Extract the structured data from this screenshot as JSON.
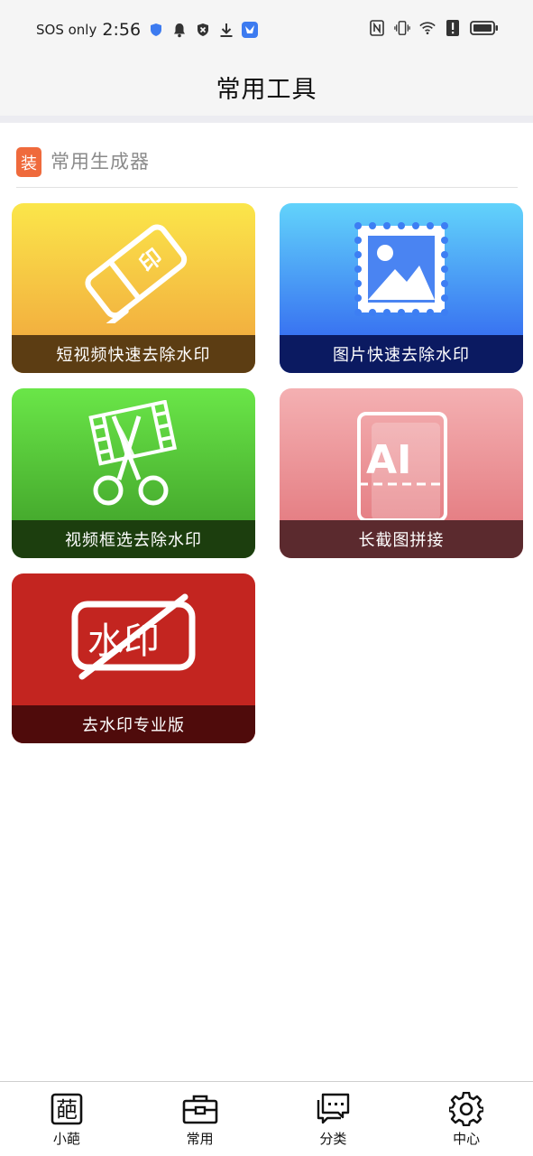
{
  "status_bar": {
    "carrier": "SOS only",
    "time": "2:56",
    "left_icons": [
      "shield-icon",
      "bell-icon",
      "vpn-shield-icon",
      "download-icon",
      "app-bird-icon"
    ],
    "right_icons": [
      "nfc-icon",
      "vibrate-icon",
      "wifi-icon",
      "alert-icon",
      "battery-icon"
    ]
  },
  "header": {
    "title": "常用工具"
  },
  "section": {
    "badge": "装",
    "title": "常用生成器"
  },
  "tools": [
    {
      "label": "短视频快速去除水印",
      "icon": "eraser-stamp-icon",
      "stamp_text": "印"
    },
    {
      "label": "图片快速去除水印",
      "icon": "picture-stamp-icon"
    },
    {
      "label": "视频框选去除水印",
      "icon": "film-scissors-icon"
    },
    {
      "label": "长截图拼接",
      "icon": "ai-long-screenshot-icon",
      "art_text": "AI"
    },
    {
      "label": "去水印专业版",
      "icon": "watermark-strike-icon",
      "art_text": "水印"
    }
  ],
  "colors": {
    "badge": "#ef6a3c",
    "card1": [
      "#fbe64a",
      "#f0a13c",
      "#5c3d13"
    ],
    "card2": [
      "#62d3fb",
      "#2d58ee",
      "#0b1a61"
    ],
    "card3": [
      "#6ae648",
      "#3c9a26",
      "#1c3e0e"
    ],
    "card4": [
      "#f4b0b2",
      "#e17278",
      "#5b2a2e"
    ],
    "card5": [
      "#c32520",
      "#4f0b0b"
    ]
  },
  "tabbar": {
    "items": [
      {
        "label": "小葩",
        "icon": "flower-char-icon",
        "icon_text": "葩"
      },
      {
        "label": "常用",
        "icon": "toolbox-icon"
      },
      {
        "label": "分类",
        "icon": "chat-bubble-icon"
      },
      {
        "label": "中心",
        "icon": "gear-icon"
      }
    ],
    "active_index": 1
  }
}
